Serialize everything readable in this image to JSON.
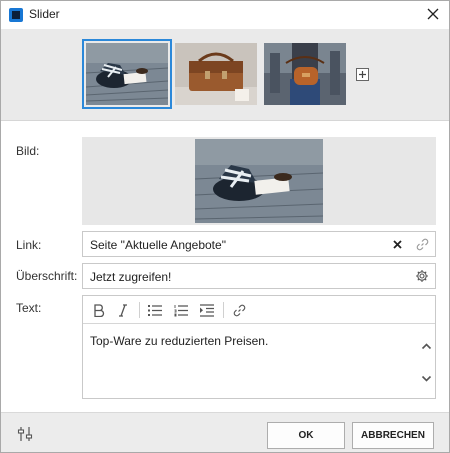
{
  "window": {
    "title": "Slider",
    "accent": "#1877d4",
    "icons": {
      "app": "app-icon",
      "close": "close-icon"
    }
  },
  "gallery": {
    "thumbnails": [
      {
        "description_icon": "slide-image-shoes",
        "selected": true
      },
      {
        "description_icon": "slide-image-bag",
        "selected": false
      },
      {
        "description_icon": "slide-image-handbag",
        "selected": false
      }
    ],
    "add_icon": "add-slide-icon",
    "selection_color": "#2b88d9"
  },
  "form": {
    "image_label": "Bild:",
    "link_label": "Link:",
    "link_value": "Seite \"Aktuelle Angebote\"",
    "heading_label": "Überschrift:",
    "heading_value": "Jetzt zugreifen!",
    "text_label": "Text:",
    "text_value": "Top-Ware zu reduzierten Preisen.",
    "toolbar_icons": [
      "bold-icon",
      "italic-icon",
      "bulleted-list-icon",
      "numbered-list-icon",
      "indent-icon",
      "link-icon"
    ]
  },
  "footer": {
    "ok_label": "OK",
    "cancel_label": "ABBRECHEN",
    "settings_icon": "settings-sliders-icon"
  }
}
